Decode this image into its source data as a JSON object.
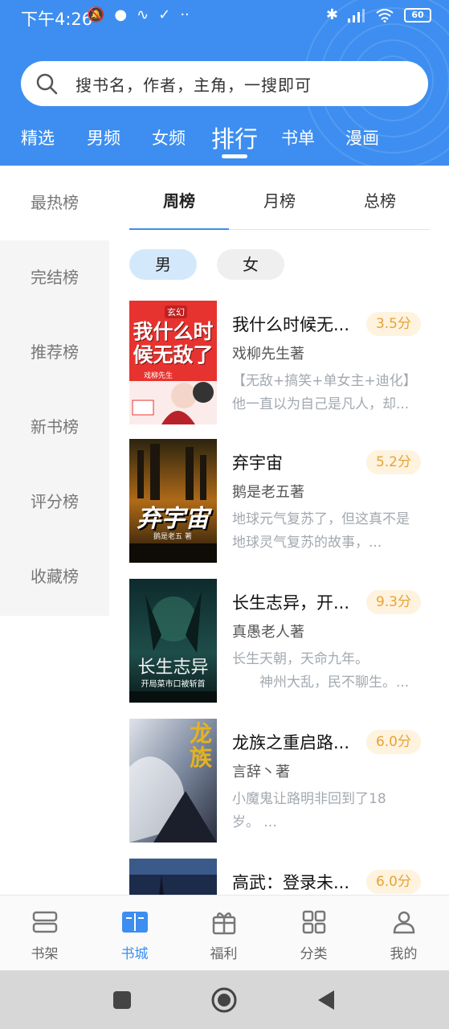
{
  "status_bar": {
    "time": "下午4:26",
    "battery": "60",
    "left_icons": [
      "mute-icon",
      "chat-icon",
      "pulse-icon",
      "check-icon",
      "dots-icon"
    ],
    "right_icons": [
      "bluetooth-icon",
      "signal-icon",
      "wifi-icon",
      "battery-icon"
    ]
  },
  "search": {
    "placeholder": "搜书名，作者，主角，一搜即可"
  },
  "top_tabs": [
    "精选",
    "男频",
    "女频",
    "排行",
    "书单",
    "漫画"
  ],
  "top_tabs_active": "排行",
  "sidebar": {
    "items": [
      "最热榜",
      "完结榜",
      "推荐榜",
      "新书榜",
      "评分榜",
      "收藏榜"
    ],
    "active": "最热榜"
  },
  "rank_tabs": {
    "items": [
      "周榜",
      "月榜",
      "总榜"
    ],
    "active": "周榜"
  },
  "gender_filter": {
    "male": "男",
    "female": "女",
    "active": "男"
  },
  "books": [
    {
      "title": "我什么时候无...",
      "score": "3.5分",
      "author": "戏柳先生著",
      "desc": [
        "【无敌+搞笑+单女主+迪化】",
        "他一直以为自己是凡人，却..."
      ],
      "cover_text": "我什么时候无敌了",
      "cover_tag": "玄幻",
      "cover_author": "戏柳先生"
    },
    {
      "title": "弃宇宙",
      "score": "5.2分",
      "author": "鹅是老五著",
      "desc": [
        "地球元气复苏了，但这真不是",
        "地球灵气复苏的故事，..."
      ],
      "cover_text": "弃宇宙",
      "cover_author": "鹅是老五 著"
    },
    {
      "title": "长生志异，开...",
      "score": "9.3分",
      "author": "真愚老人著",
      "desc": [
        "长生天朝，天命九年。",
        "　　神州大乱，民不聊生。..."
      ],
      "cover_text": "长生志异",
      "cover_sub": "开局菜市口被斩首"
    },
    {
      "title": "龙族之重启路...",
      "score": "6.0分",
      "author": "言辞丶著",
      "desc": [
        "小魔鬼让路明非回到了18",
        "岁。 ..."
      ],
      "cover_text": "龙族"
    },
    {
      "title": "高武：登录未...",
      "score": "6.0分",
      "author": "",
      "desc": []
    }
  ],
  "bottom_nav": {
    "items": [
      "书架",
      "书城",
      "福利",
      "分类",
      "我的"
    ],
    "active": "书城",
    "icons": [
      "bookshelf-icon",
      "book-open-icon",
      "gift-icon",
      "grid-icon",
      "user-icon"
    ]
  },
  "colors": {
    "primary": "#3d8ef0",
    "score_text": "#eba233",
    "score_bg": "#fdf3df"
  }
}
